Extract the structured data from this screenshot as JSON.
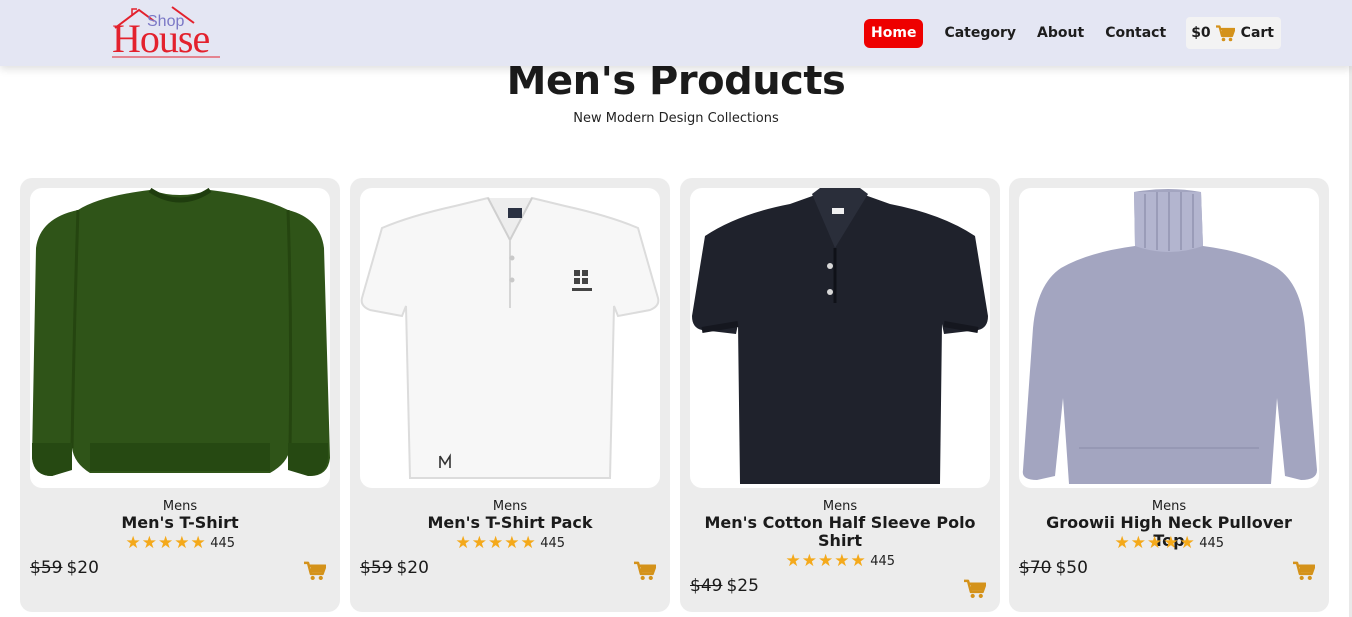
{
  "brand": {
    "small": "Shop",
    "large": "House",
    "colors": {
      "small": "#7b78c6",
      "large": "#e3212d"
    }
  },
  "nav": {
    "items": [
      {
        "label": "Home",
        "active": true
      },
      {
        "label": "Category"
      },
      {
        "label": "About"
      },
      {
        "label": "Contact"
      }
    ],
    "cart": {
      "amount": "$0",
      "label": "Cart",
      "icon": "shopping-cart-icon"
    }
  },
  "page": {
    "title": "Men's Products",
    "subtitle": "New Modern Design Collections"
  },
  "products": [
    {
      "category": "Mens",
      "name": "Men's T-Shirt",
      "rating_count": "445",
      "old_price": "$59",
      "price": "$20",
      "image": "green sweatshirt",
      "stars": 5
    },
    {
      "category": "Mens",
      "name": "Men's T-Shirt Pack",
      "rating_count": "445",
      "old_price": "$59",
      "price": "$20",
      "image": "white polo shirt",
      "stars": 5
    },
    {
      "category": "Mens",
      "name": "Men's Cotton Half Sleeve Polo Shirt",
      "rating_count": "445",
      "old_price": "$49",
      "price": "$25",
      "image": "black polo shirt",
      "stars": 5
    },
    {
      "category": "Mens",
      "name": "Groowii High Neck Pullover Top",
      "rating_count": "445",
      "old_price": "$70",
      "price": "$50",
      "image": "grey turtleneck sweater",
      "stars": 5
    }
  ],
  "theme": {
    "accent": "#ee0000",
    "star": "#f4a91b",
    "cart_icon": "#d4921a",
    "card_bg": "#ececec",
    "header_bg": "#e4e6f3"
  }
}
